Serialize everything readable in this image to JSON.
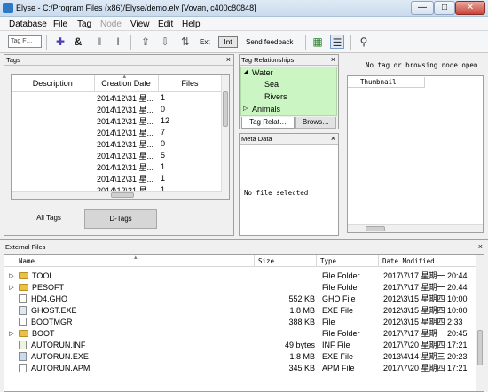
{
  "window": {
    "title": "Elyse - C:/Program Files (x86)/Elyse/demo.ely [Vovan, c400c80848]",
    "min": "—",
    "max": "□",
    "close": "✕"
  },
  "menu": [
    "Database",
    "File",
    "Tag",
    "Node",
    "View",
    "Edit",
    "Help"
  ],
  "toolbar": {
    "tag_select": "Tag F…",
    "ext_label": "Ext",
    "int_label": "Int",
    "feedback_label": "Send feedback"
  },
  "tags_panel": {
    "title": "Tags",
    "columns": [
      "Description",
      "Creation Date",
      "Files"
    ],
    "rows": [
      {
        "date": "2014\\12\\31 星...",
        "files": "1"
      },
      {
        "date": "2014\\12\\31 星...",
        "files": "0"
      },
      {
        "date": "2014\\12\\31 星...",
        "files": "12"
      },
      {
        "date": "2014\\12\\31 星...",
        "files": "7"
      },
      {
        "date": "2014\\12\\31 星...",
        "files": "0"
      },
      {
        "date": "2014\\12\\31 星...",
        "files": "5"
      },
      {
        "date": "2014\\12\\31 星...",
        "files": "1"
      },
      {
        "date": "2014\\12\\31 星...",
        "files": "1"
      },
      {
        "date": "2014\\12\\31 星...",
        "files": "1"
      }
    ],
    "tabs": [
      "All Tags",
      "D-Tags"
    ]
  },
  "tag_rel": {
    "title": "Tag Relationships",
    "nodes": [
      "Water",
      "Sea",
      "Rivers",
      "Animals"
    ],
    "tabs": [
      "Tag Relat…",
      "Brows…"
    ]
  },
  "meta": {
    "title": "Meta Data",
    "empty": "No file selected"
  },
  "thumb_panel": {
    "message": "No tag or browsing node open",
    "column": "Thumbnail"
  },
  "external": {
    "title": "External Files",
    "columns": [
      "Name",
      "Size",
      "Type",
      "Date Modified"
    ],
    "rows": [
      {
        "name": "TOOL",
        "size": "",
        "type": "File Folder",
        "date": "2017\\7\\17 星期一 20:44",
        "kind": "folder",
        "expand": "▷"
      },
      {
        "name": "PESOFT",
        "size": "",
        "type": "File Folder",
        "date": "2017\\7\\17 星期一 20:44",
        "kind": "folder",
        "expand": "▷"
      },
      {
        "name": "HD4.GHO",
        "size": "552 KB",
        "type": "GHO File",
        "date": "2012\\3\\15 星期四 10:00",
        "kind": "file",
        "expand": ""
      },
      {
        "name": "GHOST.EXE",
        "size": "1.8 MB",
        "type": "EXE File",
        "date": "2012\\3\\15 星期四 10:00",
        "kind": "file",
        "expand": ""
      },
      {
        "name": "BOOTMGR",
        "size": "388 KB",
        "type": "File",
        "date": "2012\\3\\15 星期四 2:33",
        "kind": "file",
        "expand": ""
      },
      {
        "name": "BOOT",
        "size": "",
        "type": "File Folder",
        "date": "2017\\7\\17 星期一 20:45",
        "kind": "folder",
        "expand": "▷"
      },
      {
        "name": "AUTORUN.INF",
        "size": "49 bytes",
        "type": "INF File",
        "date": "2017\\7\\20 星期四 17:21",
        "kind": "file",
        "expand": ""
      },
      {
        "name": "AUTORUN.EXE",
        "size": "1.8 MB",
        "type": "EXE File",
        "date": "2013\\4\\14 星期三 20:23",
        "kind": "file",
        "expand": ""
      },
      {
        "name": "AUTORUN.APM",
        "size": "345 KB",
        "type": "APM File",
        "date": "2017\\7\\20 星期四 17:21",
        "kind": "file",
        "expand": ""
      }
    ]
  },
  "icons": {
    "close": "×",
    "dropdown": "▾",
    "sort": "▴",
    "expanded": "◢",
    "collapsed": "▷"
  }
}
